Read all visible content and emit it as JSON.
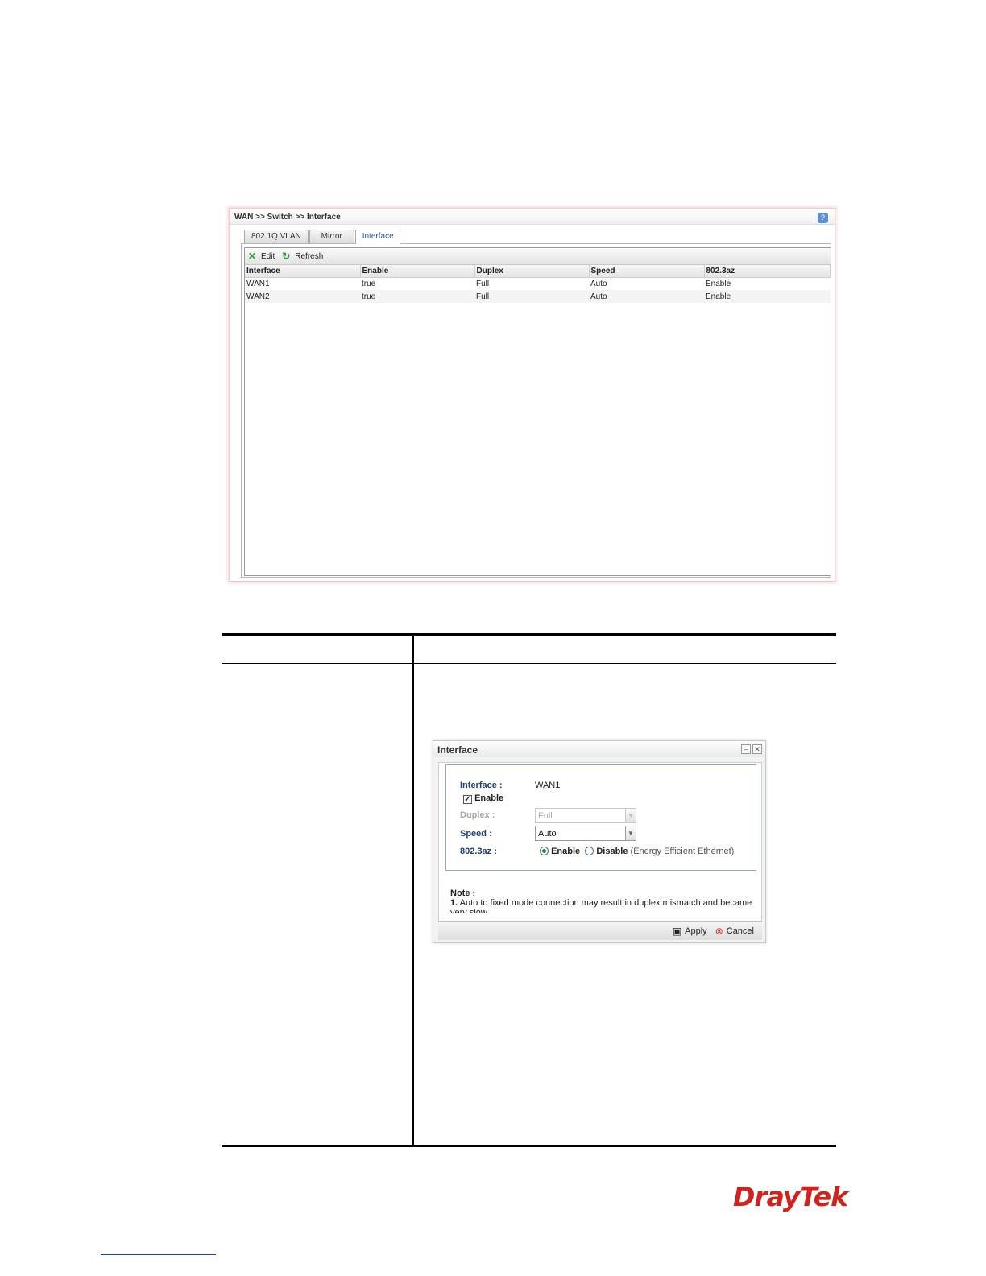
{
  "screenshot1": {
    "breadcrumb": "WAN >> Switch >> Interface",
    "tabs": [
      "802.1Q VLAN",
      "Mirror",
      "Interface"
    ],
    "toolbar": {
      "edit_label": "Edit",
      "refresh_label": "Refresh"
    },
    "table": {
      "headers": [
        "Interface",
        "Enable",
        "Duplex",
        "Speed",
        "802.3az"
      ],
      "rows": [
        [
          "WAN1",
          "true",
          "Full",
          "Auto",
          "Enable"
        ],
        [
          "WAN2",
          "true",
          "Full",
          "Auto",
          "Enable"
        ]
      ]
    }
  },
  "dialog": {
    "title": "Interface",
    "interface_label": "Interface :",
    "interface_value": "WAN1",
    "enable_label": "Enable",
    "duplex_label": "Duplex :",
    "duplex_value": "Full",
    "speed_label": "Speed :",
    "speed_value": "Auto",
    "az_label": "802.3az :",
    "az_enable": "Enable",
    "az_disable": "Disable",
    "az_hint": "(Energy Efficient Ethernet)",
    "note_title": "Note :",
    "note_num": "1.",
    "note_text": "Auto to fixed mode connection may result in duplex mismatch and became very slow.",
    "apply_label": "Apply",
    "cancel_label": "Cancel"
  },
  "brand": {
    "logo_text": "DrayTek",
    "color": "#d0231c"
  }
}
